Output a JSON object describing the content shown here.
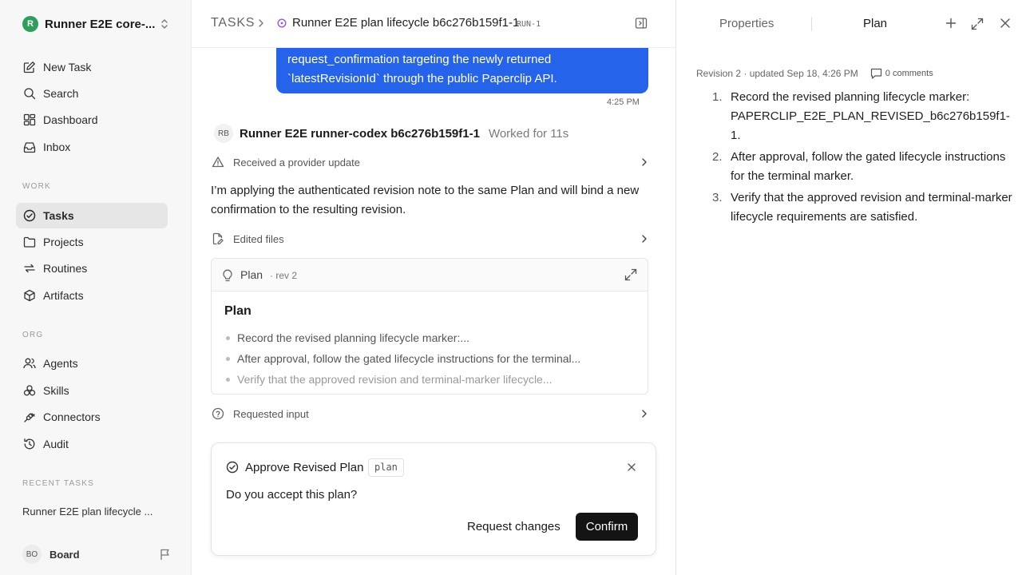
{
  "sidebar": {
    "workspace": {
      "logo": "R",
      "name": "Runner E2E core-..."
    },
    "nav_top": [
      {
        "label": "New Task",
        "icon": "edit-icon"
      },
      {
        "label": "Search",
        "icon": "search-icon"
      },
      {
        "label": "Dashboard",
        "icon": "dashboard-icon"
      },
      {
        "label": "Inbox",
        "icon": "inbox-icon"
      }
    ],
    "work_label": "WORK",
    "nav_work": [
      {
        "label": "Tasks",
        "icon": "tasks-icon",
        "active": true
      },
      {
        "label": "Projects",
        "icon": "folder-icon"
      },
      {
        "label": "Routines",
        "icon": "routines-icon"
      },
      {
        "label": "Artifacts",
        "icon": "package-icon"
      }
    ],
    "org_label": "ORG",
    "nav_org": [
      {
        "label": "Agents",
        "icon": "users-icon"
      },
      {
        "label": "Skills",
        "icon": "skills-icon"
      },
      {
        "label": "Connectors",
        "icon": "plug-icon"
      },
      {
        "label": "Audit",
        "icon": "history-icon"
      }
    ],
    "recent_label": "RECENT TASKS",
    "recent_tasks": [
      "Runner E2E plan lifecycle ..."
    ],
    "user": {
      "initials": "BO",
      "label": "Board"
    }
  },
  "header": {
    "section": "TASKS",
    "task_title": "Runner E2E plan lifecycle b6c276b159f1-1",
    "run_badge": "RUN-1"
  },
  "thread": {
    "user_message": {
      "lines": [
        "request_confirmation targeting the newly returned",
        "`latestRevisionId` through the public Paperclip API."
      ],
      "time": "4:25 PM"
    },
    "agent": {
      "initials": "RB",
      "name": "Runner E2E runner-codex b6c276b159f1-1",
      "worked": "Worked for 11s"
    },
    "event_provider": "Received a provider update",
    "agent_message": "I’m applying the authenticated revision note to the same Plan and will bind a new confirmation to the resulting revision.",
    "event_files": "Edited files",
    "plan_card": {
      "label": "Plan",
      "rev": "· rev 2",
      "title": "Plan",
      "items": [
        "Record the revised planning lifecycle marker:...",
        "After approval, follow the gated lifecycle instructions for the terminal...",
        "Verify that the approved revision and terminal-marker lifecycle..."
      ]
    },
    "event_input": "Requested input",
    "approval": {
      "title": "Approve Revised Plan",
      "badge": "plan",
      "question": "Do you accept this plan?",
      "request_changes": "Request changes",
      "confirm": "Confirm"
    }
  },
  "right_panel": {
    "tab_properties": "Properties",
    "tab_plan": "Plan",
    "revision_info": "Revision 2 · updated Sep 18, 4:26 PM",
    "comments": "0 comments",
    "steps": [
      {
        "num": "1.",
        "text": "Record the revised planning lifecycle marker: PAPERCLIP_E2E_PLAN_REVISED_b6c276b159f1-1."
      },
      {
        "num": "2.",
        "text": "After approval, follow the gated lifecycle instructions for the terminal marker."
      },
      {
        "num": "3.",
        "text": "Verify that the approved revision and terminal-marker lifecycle requirements are satisfied."
      }
    ]
  },
  "colors": {
    "accent": "#2563eb",
    "status_circle": "#9b59d0",
    "workspace_logo": "#2e9e5b",
    "confirm_button": "#141414"
  }
}
